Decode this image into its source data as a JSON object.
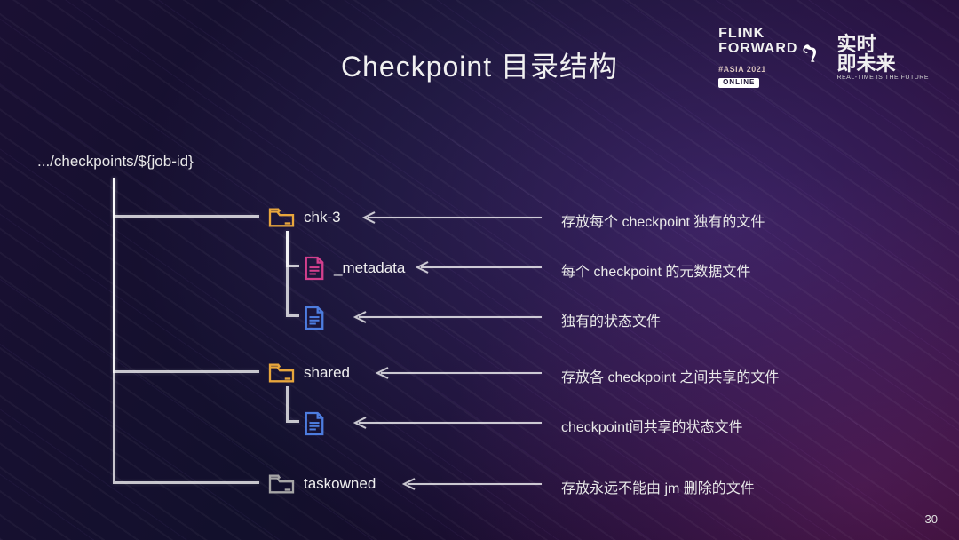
{
  "branding": {
    "line1": "FLINK",
    "line2": "FORWARD",
    "line3": "#ASIA 2021",
    "badge": "ONLINE",
    "cn1": "实时",
    "cn2": "即未来",
    "tagline": "REAL-TIME IS THE FUTURE"
  },
  "colors": {
    "folder_yellow": "#e8a63c",
    "folder_grey": "#a6a6a6",
    "file_magenta": "#d43f8d",
    "file_blue": "#4d7de0"
  },
  "title": "Checkpoint 目录结构",
  "root_path": ".../checkpoints/${job-id}",
  "nodes": {
    "chk": {
      "label": "chk-3",
      "desc": "存放每个 checkpoint 独有的文件"
    },
    "metadata": {
      "label": "_metadata",
      "desc": "每个 checkpoint 的元数据文件"
    },
    "state1": {
      "label": "",
      "desc": "独有的状态文件"
    },
    "shared": {
      "label": "shared",
      "desc": "存放各 checkpoint 之间共享的文件"
    },
    "state2": {
      "label": "",
      "desc": "checkpoint间共享的状态文件"
    },
    "taskowned": {
      "label": "taskowned",
      "desc": "存放永远不能由 jm 删除的文件"
    }
  },
  "page_number": "30"
}
